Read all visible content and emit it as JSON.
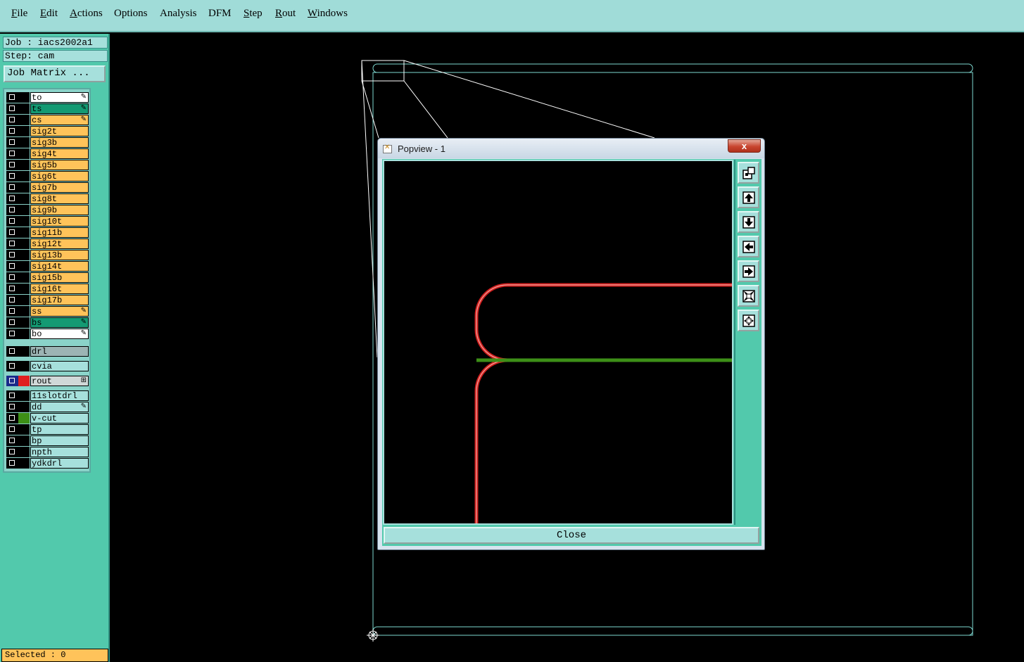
{
  "menu": {
    "items": [
      {
        "label": "File"
      },
      {
        "label": "Edit"
      },
      {
        "label": "Actions"
      },
      {
        "label": "Options"
      },
      {
        "label": "Analysis"
      },
      {
        "label": "DFM"
      },
      {
        "label": "Step"
      },
      {
        "label": "Rout"
      },
      {
        "label": "Windows"
      }
    ]
  },
  "info": {
    "job": "Job : iacs2002a1",
    "step": "Step: cam",
    "job_matrix_button": "Job Matrix ..."
  },
  "layers": [
    {
      "name": "to",
      "color": "#ffffff",
      "mark": "✎"
    },
    {
      "name": "ts",
      "color": "#149a73",
      "mark": "✎"
    },
    {
      "name": "cs",
      "color": "#ffc35a",
      "mark": "✎"
    },
    {
      "name": "sig2t",
      "color": "#ffc35a",
      "mark": ""
    },
    {
      "name": "sig3b",
      "color": "#ffc35a",
      "mark": ""
    },
    {
      "name": "sig4t",
      "color": "#ffc35a",
      "mark": ""
    },
    {
      "name": "sig5b",
      "color": "#ffc35a",
      "mark": ""
    },
    {
      "name": "sig6t",
      "color": "#ffc35a",
      "mark": ""
    },
    {
      "name": "sig7b",
      "color": "#ffc35a",
      "mark": ""
    },
    {
      "name": "sig8t",
      "color": "#ffc35a",
      "mark": ""
    },
    {
      "name": "sig9b",
      "color": "#ffc35a",
      "mark": ""
    },
    {
      "name": "sig10t",
      "color": "#ffc35a",
      "mark": ""
    },
    {
      "name": "sig11b",
      "color": "#ffc35a",
      "mark": ""
    },
    {
      "name": "sig12t",
      "color": "#ffc35a",
      "mark": ""
    },
    {
      "name": "sig13b",
      "color": "#ffc35a",
      "mark": ""
    },
    {
      "name": "sig14t",
      "color": "#ffc35a",
      "mark": ""
    },
    {
      "name": "sig15b",
      "color": "#ffc35a",
      "mark": ""
    },
    {
      "name": "sig16t",
      "color": "#ffc35a",
      "mark": ""
    },
    {
      "name": "sig17b",
      "color": "#ffc35a",
      "mark": ""
    },
    {
      "name": "ss",
      "color": "#ffc35a",
      "mark": "✎"
    },
    {
      "name": "bs",
      "color": "#149a73",
      "mark": "✎"
    },
    {
      "name": "bo",
      "color": "#ffffff",
      "mark": "✎"
    }
  ],
  "drill_layers": [
    {
      "name": "drl",
      "color": "#9cb4b4",
      "mark": ""
    },
    {
      "name": "cvia",
      "color": "#a6e0dc",
      "mark": ""
    },
    {
      "name": "rout",
      "color": "#d0d8d8",
      "mark": "⊞",
      "active": true
    }
  ],
  "misc_layers": [
    {
      "name": "11slotdrl",
      "color": "#a6e0dc",
      "mark": ""
    },
    {
      "name": "dd",
      "color": "#a6e0dc",
      "mark": "✎"
    },
    {
      "name": "v-cut",
      "color": "#a6e0dc",
      "mark": "",
      "swatch": "#3d8f17"
    },
    {
      "name": "tp",
      "color": "#a6e0dc",
      "mark": ""
    },
    {
      "name": "bp",
      "color": "#a6e0dc",
      "mark": ""
    },
    {
      "name": "npth",
      "color": "#a6e0dc",
      "mark": ""
    },
    {
      "name": "ydkdrl",
      "color": "#a6e0dc",
      "mark": ""
    }
  ],
  "status": {
    "selected": "Selected : 0"
  },
  "popview": {
    "title": "Popview - 1",
    "close_x": "x",
    "close_button": "Close",
    "toolbar_icons": [
      "zoom-window-icon",
      "pan-up-icon",
      "pan-down-icon",
      "pan-left-icon",
      "pan-right-icon",
      "zoom-out-icon",
      "zoom-in-icon"
    ]
  },
  "colors": {
    "profile": "#7ed8d0",
    "rout_path": "#d42020",
    "vcut_path": "#3d8f17",
    "panel": "#52c9ac"
  }
}
